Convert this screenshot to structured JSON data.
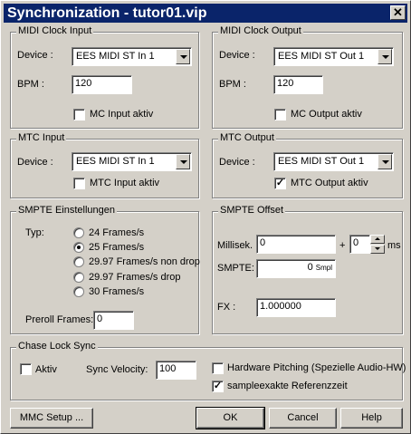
{
  "window": {
    "title": "Synchronization - tutor01.vip",
    "close_label": "✕"
  },
  "midi_clock_input": {
    "title": "MIDI Clock Input",
    "device_label": "Device :",
    "device_value": "EES MIDI ST In 1",
    "bpm_label": "BPM :",
    "bpm_value": "120",
    "checkbox_label": "MC Input aktiv",
    "checked": false
  },
  "midi_clock_output": {
    "title": "MIDI Clock Output",
    "device_label": "Device :",
    "device_value": "EES MIDI ST Out 1",
    "bpm_label": "BPM :",
    "bpm_value": "120",
    "checkbox_label": "MC Output aktiv",
    "checked": false
  },
  "mtc_input": {
    "title": "MTC Input",
    "device_label": "Device :",
    "device_value": "EES MIDI ST In 1",
    "checkbox_label": "MTC Input aktiv",
    "checked": false
  },
  "mtc_output": {
    "title": "MTC Output",
    "device_label": "Device :",
    "device_value": "EES MIDI ST Out 1",
    "checkbox_label": "MTC Output aktiv",
    "checked": true
  },
  "smpte_settings": {
    "title": "SMPTE Einstellungen",
    "typ_label": "Typ:",
    "options": [
      "24 Frames/s",
      "25 Frames/s",
      "29.97 Frames/s non drop",
      "29.97 Frames/s drop",
      "30 Frames/s"
    ],
    "selected_index": 1,
    "preroll_label": "Preroll Frames:",
    "preroll_value": "0"
  },
  "smpte_offset": {
    "title": "SMPTE Offset",
    "millisek_label": "Millisek.",
    "millisek_value": "0",
    "plus_label": "+",
    "ms_value": "0",
    "ms_label": "ms",
    "smpte_label": "SMPTE:",
    "smpte_value": "0",
    "smpte_unit": "Smpl",
    "fx_label": "FX :",
    "fx_value": "1.000000"
  },
  "chase_lock": {
    "title": "Chase Lock Sync",
    "aktiv_label": "Aktiv",
    "aktiv_checked": false,
    "sync_velocity_label": "Sync Velocity:",
    "sync_velocity_value": "100",
    "hw_pitching_label": "Hardware Pitching (Spezielle Audio-HW)",
    "hw_pitching_checked": false,
    "sample_exact_label": "sampleexakte Referenzzeit",
    "sample_exact_checked": true
  },
  "buttons": {
    "mmc_setup": "MMC Setup ...",
    "ok": "OK",
    "cancel": "Cancel",
    "help": "Help"
  },
  "colors": {
    "titlebar": "#0a246a",
    "face": "#d4d0c8"
  },
  "check_mark": "✓"
}
